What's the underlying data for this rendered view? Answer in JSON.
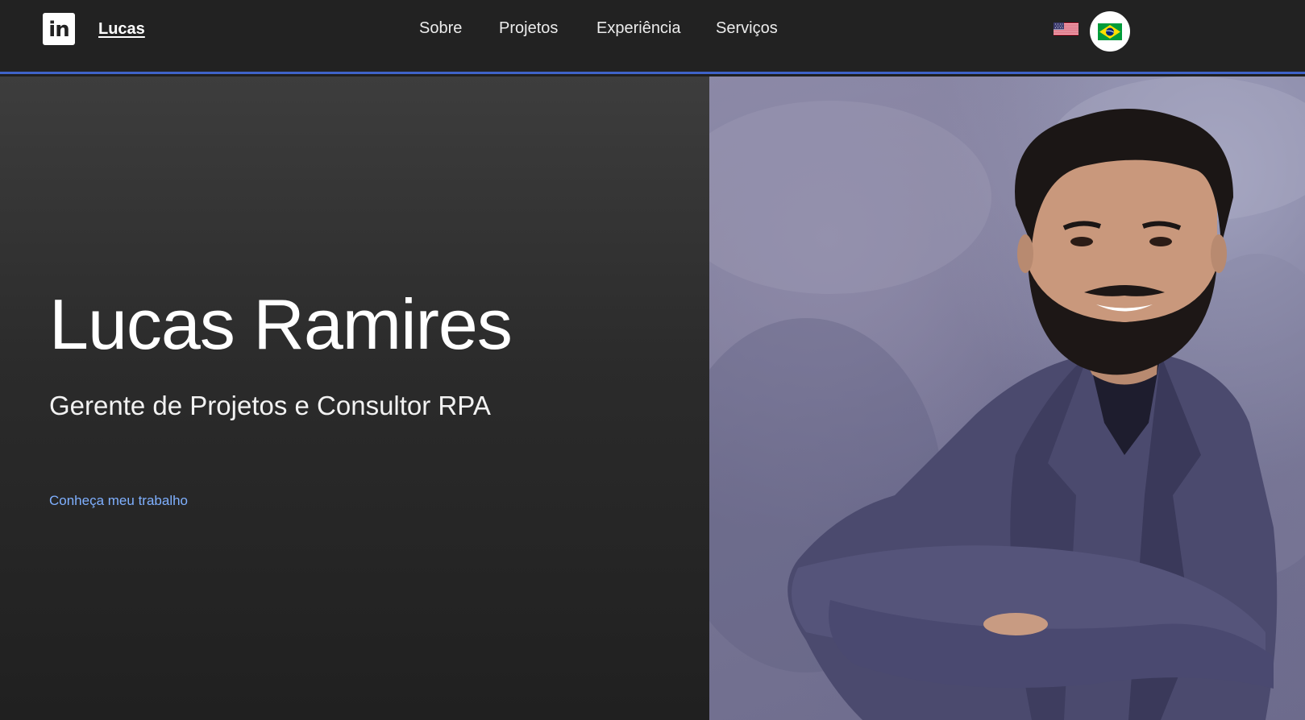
{
  "header": {
    "linkedin_icon": "linkedin-icon",
    "linkedin_text": "in",
    "brand": "Lucas",
    "nav": [
      {
        "label": "Sobre"
      },
      {
        "label": "Projetos"
      },
      {
        "label": "Experiência"
      },
      {
        "label": "Serviços"
      }
    ],
    "language_flags": [
      "us-flag-icon",
      "brazil-flag-icon"
    ]
  },
  "hero": {
    "name": "Lucas Ramires",
    "role": "Gerente de Projetos e Consultor RPA",
    "cta": "Conheça meu trabalho",
    "photo": "portrait-photo"
  },
  "colors": {
    "header_bg": "#222222",
    "accent_line": "#3f63c8",
    "link": "#7fb0ff",
    "hero_bg": "#2b2b2b"
  }
}
